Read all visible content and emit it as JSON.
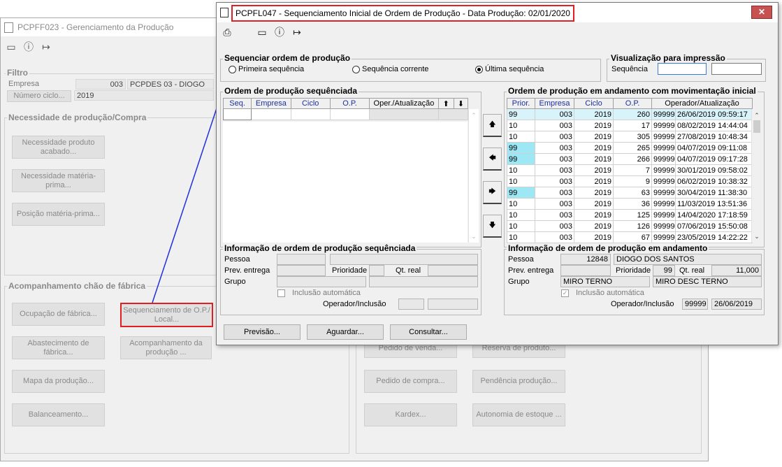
{
  "bg": {
    "title": "PCPFF023 - Gerenciamento da Produção",
    "filtro": {
      "title": "Filtro",
      "empresa_label": "Empresa",
      "empresa_code": "003",
      "empresa_name": "PCPDES 03 - DIOGO",
      "ciclo_button": "Número ciclo...",
      "ciclo_value": "2019"
    },
    "necessidade": {
      "title": "Necessidade de produção/Compra",
      "buttons": [
        "Necessidade produto acabado...",
        "Necessidade matéria-prima...",
        "Posição matéria-prima..."
      ]
    },
    "chao": {
      "title": "Acompanhamento chão de fábrica",
      "buttons": [
        "Ocupação de fábrica...",
        "Sequenciamento de O.P./ Local...",
        "Abastecimento de fábrica...",
        "Acompanhamento da produção ...",
        "Mapa da produção...",
        "Balanceamento..."
      ]
    },
    "right_buttons": [
      "Pedido de venda...",
      "Reserva de produto...",
      "Pedido de compra...",
      "Pendência produção...",
      "Kardex...",
      "Autonomia de estoque ..."
    ]
  },
  "dialog": {
    "title": "PCPFL047 - Sequenciamento Inicial de Ordem de Produção - Data Produção: 02/01/2020",
    "close": "✕",
    "sequenciar": {
      "title": "Sequenciar ordem de produção",
      "options": [
        "Primeira sequência",
        "Sequência corrente",
        "Última sequência"
      ],
      "selected": "Última sequência"
    },
    "visualizacao": {
      "title": "Visualização para impressão",
      "label": "Sequência",
      "value1": "",
      "value2": ""
    },
    "left_grid": {
      "title": "Ordem de produção sequênciada",
      "columns": [
        "Seq.",
        "Empresa",
        "Ciclo",
        "O.P.",
        "Oper./Atualização",
        "⬆",
        "⬇"
      ]
    },
    "right_grid": {
      "title": "Ordem de produção em andamento com movimentação inicial",
      "columns": [
        "Prior.",
        "Empresa",
        "Ciclo",
        "O.P.",
        "Operador/Atualização"
      ],
      "rows": [
        {
          "prior": "99",
          "empresa": "003",
          "ciclo": "2019",
          "op": "260",
          "oper": "99999",
          "data": "26/06/2019 09:59:17"
        },
        {
          "prior": "10",
          "empresa": "003",
          "ciclo": "2019",
          "op": "17",
          "oper": "99999",
          "data": "08/02/2019 14:44:04"
        },
        {
          "prior": "10",
          "empresa": "003",
          "ciclo": "2019",
          "op": "305",
          "oper": "99999",
          "data": "27/08/2019 10:48:34"
        },
        {
          "prior": "99",
          "empresa": "003",
          "ciclo": "2019",
          "op": "265",
          "oper": "99999",
          "data": "04/07/2019 09:11:08"
        },
        {
          "prior": "99",
          "empresa": "003",
          "ciclo": "2019",
          "op": "266",
          "oper": "99999",
          "data": "04/07/2019 09:17:28"
        },
        {
          "prior": "10",
          "empresa": "003",
          "ciclo": "2019",
          "op": "7",
          "oper": "99999",
          "data": "30/01/2019 09:58:02"
        },
        {
          "prior": "10",
          "empresa": "003",
          "ciclo": "2019",
          "op": "9",
          "oper": "99999",
          "data": "06/02/2019 10:38:32"
        },
        {
          "prior": "99",
          "empresa": "003",
          "ciclo": "2019",
          "op": "63",
          "oper": "99999",
          "data": "30/04/2019 11:38:30"
        },
        {
          "prior": "10",
          "empresa": "003",
          "ciclo": "2019",
          "op": "36",
          "oper": "99999",
          "data": "11/03/2019 13:51:36"
        },
        {
          "prior": "10",
          "empresa": "003",
          "ciclo": "2019",
          "op": "125",
          "oper": "99999",
          "data": "14/04/2020 17:18:59"
        },
        {
          "prior": "10",
          "empresa": "003",
          "ciclo": "2019",
          "op": "126",
          "oper": "99999",
          "data": "07/06/2019 15:50:08"
        },
        {
          "prior": "10",
          "empresa": "003",
          "ciclo": "2019",
          "op": "67",
          "oper": "99999",
          "data": "23/05/2019 14:22:22"
        }
      ]
    },
    "arrows": [
      "🡅",
      "🡄",
      "🡆",
      "🡇"
    ],
    "left_info": {
      "title": "Informação de ordem de produção sequênciada",
      "pessoa": "Pessoa",
      "prev_entrega": "Prev. entrega",
      "prioridade": "Prioridade",
      "qt_real": "Qt. real",
      "grupo": "Grupo",
      "inclusao": "Inclusão automática",
      "operador": "Operador/Inclusão"
    },
    "right_info": {
      "title": "Informação de ordem de produção em andamento",
      "pessoa": "Pessoa",
      "pessoa_code": "12848",
      "pessoa_name": "DIOGO DOS SANTOS",
      "prev_entrega": "Prev. entrega",
      "prioridade": "Prioridade",
      "prioridade_value": "99",
      "qt_real": "Qt. real",
      "qt_real_value": "11,000",
      "grupo": "Grupo",
      "grupo_code": "MIRO TERNO",
      "grupo_desc": "MIRO DESC TERNO",
      "inclusao": "Inclusão automática",
      "operador": "Operador/Inclusão",
      "operador_value": "99999",
      "inclusao_data": "26/06/2019"
    },
    "buttons": [
      "Previsão...",
      "Aguardar...",
      "Consultar..."
    ]
  }
}
